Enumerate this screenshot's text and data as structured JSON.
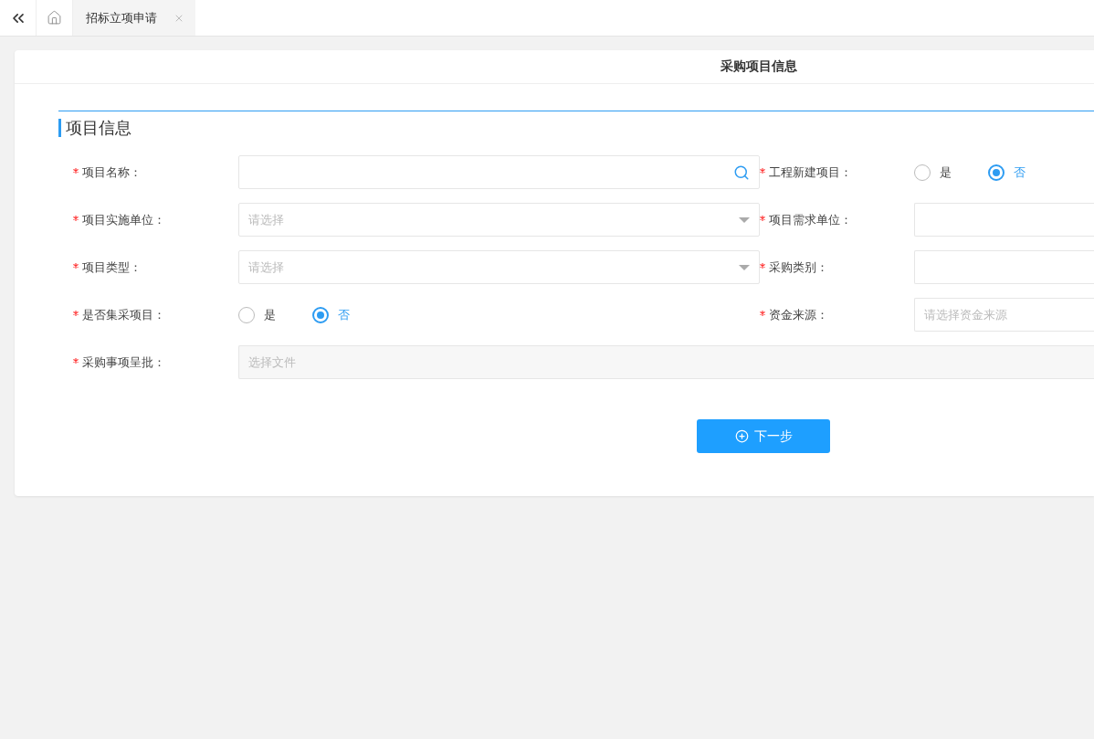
{
  "tabbar": {
    "tabs": [
      {
        "label": "招标立项申请",
        "selected": true
      }
    ]
  },
  "card": {
    "title": "采购项目信息",
    "section": "项目信息",
    "rows": [
      [
        {
          "label": "项目名称：",
          "required": true,
          "kind": "search"
        },
        {
          "label": "工程新建项目：",
          "required": true,
          "kind": "radio",
          "options": [
            {
              "label": "是",
              "selected": false
            },
            {
              "label": "否",
              "selected": true
            }
          ]
        }
      ],
      [
        {
          "label": "项目实施单位：",
          "required": true,
          "kind": "select",
          "placeholder": "请选择"
        },
        {
          "label": "项目需求单位：",
          "required": true,
          "kind": "text"
        }
      ],
      [
        {
          "label": "项目类型：",
          "required": true,
          "kind": "select",
          "placeholder": "请选择"
        },
        {
          "label": "采购类别：",
          "required": true,
          "kind": "text"
        }
      ],
      [
        {
          "label": "是否集采项目：",
          "required": true,
          "kind": "radio",
          "options": [
            {
              "label": "是",
              "selected": false
            },
            {
              "label": "否",
              "selected": true
            }
          ]
        },
        {
          "label": "资金来源：",
          "required": true,
          "kind": "text",
          "placeholder": "请选择资金来源"
        }
      ],
      [
        {
          "label": "采购事项呈批：",
          "required": true,
          "kind": "file",
          "placeholder": "选择文件"
        }
      ]
    ],
    "next_button": "下一步"
  }
}
